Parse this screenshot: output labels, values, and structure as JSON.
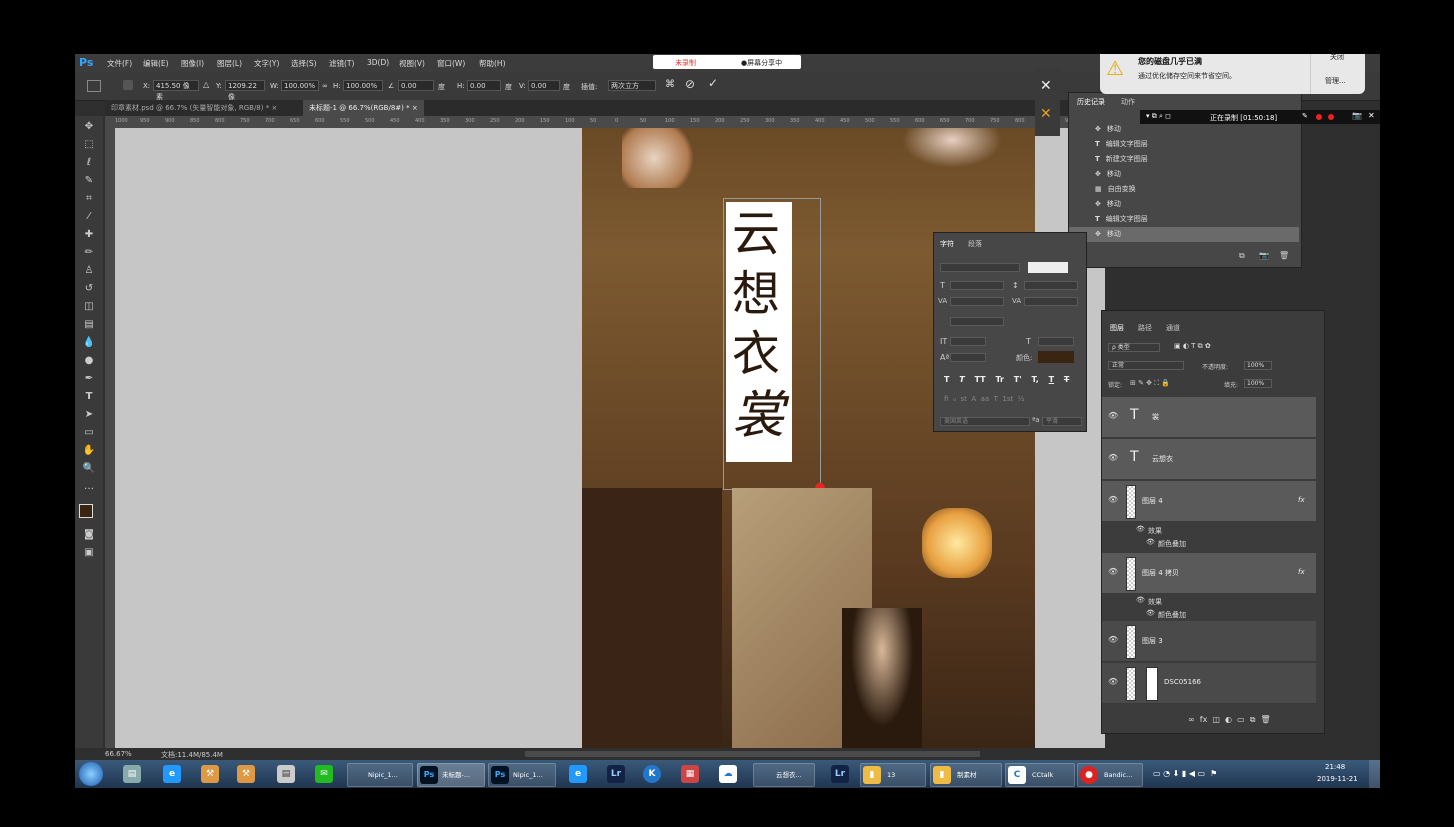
{
  "menu": {
    "logo": "Ps",
    "items": [
      "文件(F)",
      "编辑(E)",
      "图像(I)",
      "图层(L)",
      "文字(Y)",
      "选择(S)",
      "滤镜(T)",
      "3D(D)",
      "视图(V)",
      "窗口(W)",
      "帮助(H)"
    ]
  },
  "recording": {
    "not_recording": "未录制",
    "screen_share": "●屏幕分享中"
  },
  "options": {
    "x_label": "X:",
    "x_value": "415.50 像素",
    "y_label": "Y:",
    "y_value": "1209.22 像",
    "w_label": "W:",
    "w_value": "100.00%",
    "h_label": "H:",
    "h_value": "100.00%",
    "angle_value": "0.00",
    "angle_unit": "度",
    "hskew_label": "H:",
    "hskew_value": "0.00",
    "hskew_unit": "度",
    "vskew_label": "V:",
    "vskew_value": "0.00",
    "vskew_unit": "度",
    "interp_label": "插值:",
    "interp_value": "两次立方"
  },
  "tabs": [
    {
      "label": "印章素材.psd @ 66.7% (矢量智能对象, RGB/8) *"
    },
    {
      "label": "未标题-1 @ 66.7%(RGB/8#) *"
    }
  ],
  "ruler_ticks": [
    "1000",
    "950",
    "900",
    "850",
    "800",
    "750",
    "700",
    "650",
    "600",
    "550",
    "500",
    "450",
    "400",
    "350",
    "300",
    "250",
    "200",
    "150",
    "100",
    "50",
    "0",
    "50",
    "100",
    "150",
    "200",
    "250",
    "300",
    "350",
    "400",
    "450",
    "500",
    "550",
    "600",
    "650",
    "700",
    "750",
    "800",
    "850",
    "900"
  ],
  "canvas_text": {
    "title_chars": [
      "云",
      "想",
      "衣",
      "裳"
    ]
  },
  "status": {
    "zoom": "66.67%",
    "doc": "文档:11.4M/85.4M"
  },
  "notification": {
    "title": "您的磁盘几乎已满",
    "body": "通过优化储存空间来节省空间。",
    "close": "关闭",
    "manage": "管理..."
  },
  "recorder_bar": {
    "text": "正在录制 [01:50:18]"
  },
  "history": {
    "tabs": [
      "历史记录",
      "动作"
    ],
    "rows": [
      {
        "icon": "✥",
        "label": "移动"
      },
      {
        "icon": "T",
        "label": "编辑文字图层"
      },
      {
        "icon": "T",
        "label": "新建文字图层"
      },
      {
        "icon": "✥",
        "label": "移动"
      },
      {
        "icon": "▦",
        "label": "自由变换"
      },
      {
        "icon": "✥",
        "label": "移动"
      },
      {
        "icon": "T",
        "label": "编辑文字图层"
      },
      {
        "icon": "✥",
        "label": "移动"
      }
    ]
  },
  "character": {
    "tabs": [
      "字符",
      "段落"
    ],
    "color_label": "颜色:",
    "style_buttons": [
      "T",
      "T",
      "TT",
      "Tr",
      "T'",
      "T,",
      "T",
      "T"
    ],
    "lang": "美国英语",
    "aa": "平滑",
    "text_color": "#3a2412"
  },
  "layers": {
    "tabs": [
      "图层",
      "路径",
      "通道"
    ],
    "filter": "ρ 类型",
    "blend": "正常",
    "opacity_label": "不透明度:",
    "opacity": "100%",
    "lock_label": "锁定:",
    "fill_label": "填充:",
    "fill": "100%",
    "rows": [
      {
        "type": "text",
        "name": "裳"
      },
      {
        "type": "text",
        "name": "云想衣"
      },
      {
        "type": "image",
        "name": "图层 4",
        "fx": "fx",
        "effects": "效果",
        "effect_item": "颜色叠加"
      },
      {
        "type": "image",
        "name": "图层 4 拷贝",
        "fx": "fx",
        "effects": "效果",
        "effect_item": "颜色叠加"
      },
      {
        "type": "image",
        "name": "图层 3"
      },
      {
        "type": "image",
        "name": "DSC05166"
      }
    ]
  },
  "taskbar": {
    "buttons": [
      "Nipic_1...",
      "未标题-...",
      "Nipic_1...",
      "云想衣...",
      "13",
      "制素材",
      "CCtalk",
      "Bandic..."
    ],
    "time": "21:48",
    "date": "2019-11-21"
  }
}
